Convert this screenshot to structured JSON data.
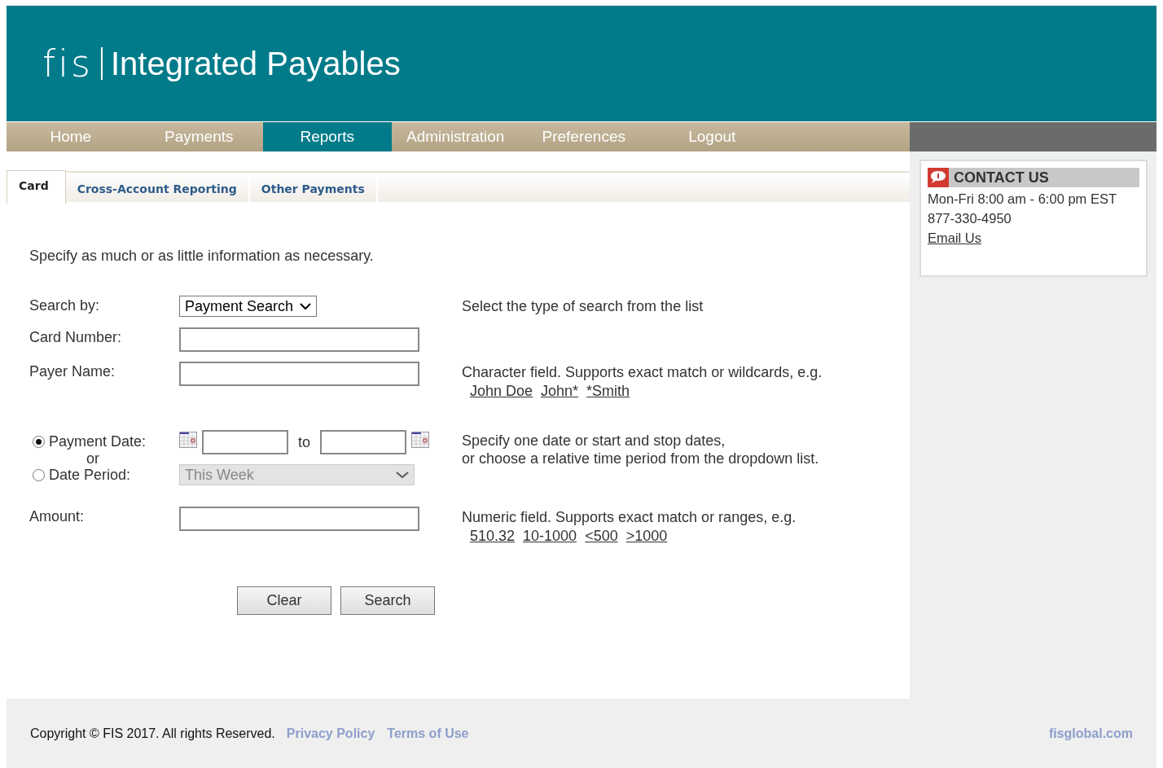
{
  "header": {
    "logo": "fis",
    "title": "Integrated Payables"
  },
  "nav": [
    {
      "label": "Home",
      "selected": false
    },
    {
      "label": "Payments",
      "selected": false
    },
    {
      "label": "Reports",
      "selected": true
    },
    {
      "label": "Administration",
      "selected": false
    },
    {
      "label": "Preferences",
      "selected": false
    },
    {
      "label": "Logout",
      "selected": false
    }
  ],
  "tabs": [
    {
      "label": "Card",
      "selected": true
    },
    {
      "label": "Cross-Account Reporting",
      "selected": false
    },
    {
      "label": "Other Payments",
      "selected": false
    }
  ],
  "intro": "Specify as much or as little information as necessary.",
  "form": {
    "search_by": {
      "label": "Search by:",
      "value": "Payment Search",
      "help": "Select the type of search from the list"
    },
    "card_number": {
      "label": "Card Number:"
    },
    "payer_name": {
      "label": "Payer Name:",
      "help": "Character field. Supports exact match or wildcards, e.g.",
      "examples": [
        "John Doe",
        "John*",
        "*Smith"
      ]
    },
    "date_modes": [
      {
        "label": "Payment Date:",
        "selected": true
      },
      {
        "label": "Date Period:",
        "selected": false
      }
    ],
    "or": "or",
    "to": "to",
    "date_period": {
      "value": "This Week",
      "disabled": true
    },
    "date_help": [
      "Specify one date or start and stop dates,",
      "or choose a relative time period from the dropdown list."
    ],
    "amount": {
      "label": "Amount:",
      "help": "Numeric field. Supports exact match or ranges, e.g.",
      "examples": [
        "510.32",
        "10-1000",
        "<500",
        ">1000"
      ]
    },
    "buttons": [
      "Clear",
      "Search"
    ]
  },
  "contact": {
    "title": "CONTACT US",
    "hours": "Mon-Fri 8:00 am - 6:00 pm EST",
    "phone": "877-330-4950",
    "email": "Email Us"
  },
  "footer": {
    "copyright": "Copyright © FIS 2017. All rights Reserved.",
    "links": [
      "Privacy Policy",
      "Terms of Use"
    ],
    "site": "fisglobal.com"
  }
}
